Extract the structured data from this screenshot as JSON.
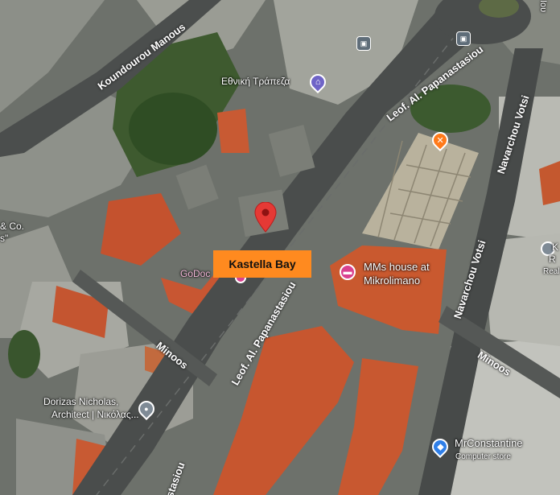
{
  "map": {
    "type": "satellite",
    "selected_place_label": "Kastella Bay",
    "colors": {
      "callout_bg": "#ff8a1f",
      "pin_red": "#e53935",
      "bank_purple": "#6f64c7",
      "hotel_pink": "#d9418f",
      "food_orange": "#ff7a1a",
      "service_gray": "#7f8b96",
      "store_blue": "#2f7fe8",
      "roof_orange": "#c8552f"
    }
  },
  "streets": {
    "koundourou": "Koundourou Manous",
    "papanastasiou_upper": "Leof. Al. Papanastasiou",
    "papanastasiou_mid": "Leof. Al. Papanastasiou",
    "papanastasiou_lower": "stasiou",
    "navarchou_upper": "Navarchou Votsi",
    "navarchou_lower": "Navarchou Votsi",
    "minoos_left": "Minoos",
    "minoos_right": "Minoos"
  },
  "pois": {
    "bank": {
      "name": "Εθνική Τράπεζα",
      "icon": "bank-icon"
    },
    "mms_house": {
      "line1": "MMs house at",
      "line2": "Mikrolimano",
      "icon": "hotel-icon"
    },
    "godoc": {
      "name": "GoDoc",
      "icon": "pin-icon"
    },
    "dorizas": {
      "line1": "Dorizas Nicholas,",
      "line2": "Architect | Νικόλας...",
      "icon": "place-icon"
    },
    "mrconstantine": {
      "name": "MrConstantine",
      "sub": "Computer store",
      "icon": "shopping-bag-icon"
    },
    "restaurant": {
      "icon": "fork-knife-icon"
    },
    "partial_left": {
      "line1": "& Co.",
      "line2": "s\""
    },
    "partial_right": {
      "line1": "K",
      "line2": "R",
      "line3": "Real"
    },
    "edge_text": "Ιου"
  }
}
